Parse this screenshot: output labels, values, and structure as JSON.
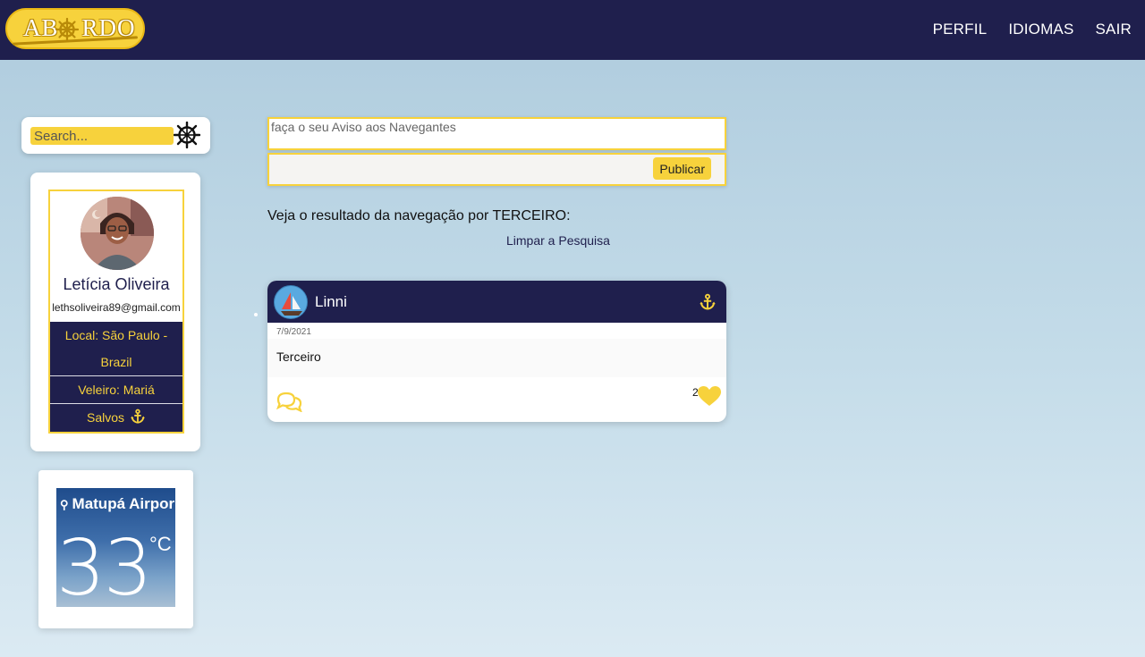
{
  "header": {
    "logo_text_left": "AB",
    "logo_text_right": "RDO",
    "nav": [
      "PERFIL",
      "IDIOMAS",
      "SAIR"
    ]
  },
  "search": {
    "placeholder": "Search..."
  },
  "profile": {
    "name": "Letícia Oliveira",
    "email": "lethsoliveira89@gmail.com",
    "local": "Local: São Paulo - Brazil",
    "veleiro": "Veleiro: Mariá",
    "salvos": "Salvos"
  },
  "weather": {
    "location": "Matupá Airpor",
    "temperature": "33",
    "unit": "°C"
  },
  "composer": {
    "placeholder": "faça o seu Aviso aos Navegantes",
    "publish_label": "Publicar"
  },
  "results": {
    "heading": "Veja o resultado da navegação por TERCEIRO:",
    "clear_label": "Limpar a Pesquisa"
  },
  "post": {
    "author": "Linni",
    "date": "7/9/2021",
    "text": "Terceiro",
    "likes": "2"
  },
  "colors": {
    "navy": "#1f1f4d",
    "yellow": "#f7d23c"
  }
}
